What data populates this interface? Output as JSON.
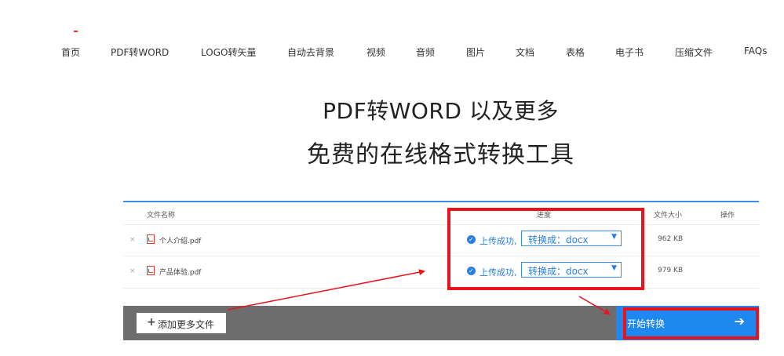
{
  "nav": [
    "首页",
    "PDF转WORD",
    "LOGO转矢量",
    "自动去背景",
    "视频",
    "音频",
    "图片",
    "文档",
    "表格",
    "电子书",
    "压缩文件",
    "FAQs"
  ],
  "hero": {
    "line1": "PDF转WORD 以及更多",
    "line2": "免费的在线格式转换工具"
  },
  "table": {
    "headers": {
      "name": "文件名称",
      "progress": "进度",
      "size": "文件大小",
      "action": "操作"
    },
    "rows": [
      {
        "remove": "×",
        "name": "个人介绍.pdf",
        "status": "上传成功,",
        "format": "转换成：docx",
        "size": "962 KB"
      },
      {
        "remove": "×",
        "name": "产品体验.pdf",
        "status": "上传成功,",
        "format": "转换成：docx",
        "size": "979 KB"
      }
    ]
  },
  "actions": {
    "add_more": "添加更多文件",
    "start": "开始转换"
  },
  "colors": {
    "accent": "#1e87f0",
    "bar": "#6d6d6d",
    "annotation": "#e8141c"
  },
  "icons": {
    "file": "pdf-file-icon",
    "status": "check-circle-icon",
    "dropdown": "chevron-down-icon",
    "add": "plus-icon",
    "start": "arrow-right-icon",
    "remove": "close-icon"
  }
}
